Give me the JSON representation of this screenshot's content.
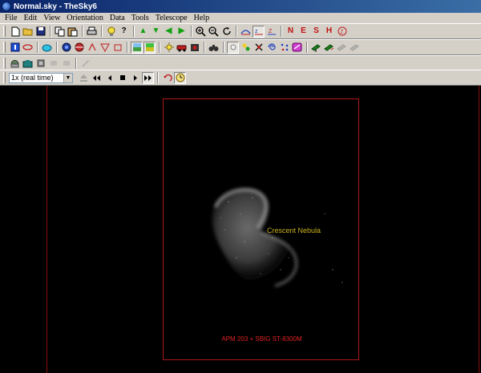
{
  "window": {
    "title": "Normal.sky - TheSky6"
  },
  "menu": [
    "File",
    "Edit",
    "View",
    "Orientation",
    "Data",
    "Tools",
    "Telescope",
    "Help"
  ],
  "toolbar_main": {
    "north": "N",
    "east": "E",
    "south": "S",
    "horizon": "H"
  },
  "time_toolbar": {
    "rate_select": "1x (real time)"
  },
  "sky": {
    "object_label": "Crescent Nebula",
    "sensor_label": "APM 203 + SBIG ST-8300M"
  },
  "colors": {
    "frame": "#b01818",
    "label_object": "#c8b020",
    "label_sensor": "#e02020",
    "titlebar": "#0a246a"
  }
}
